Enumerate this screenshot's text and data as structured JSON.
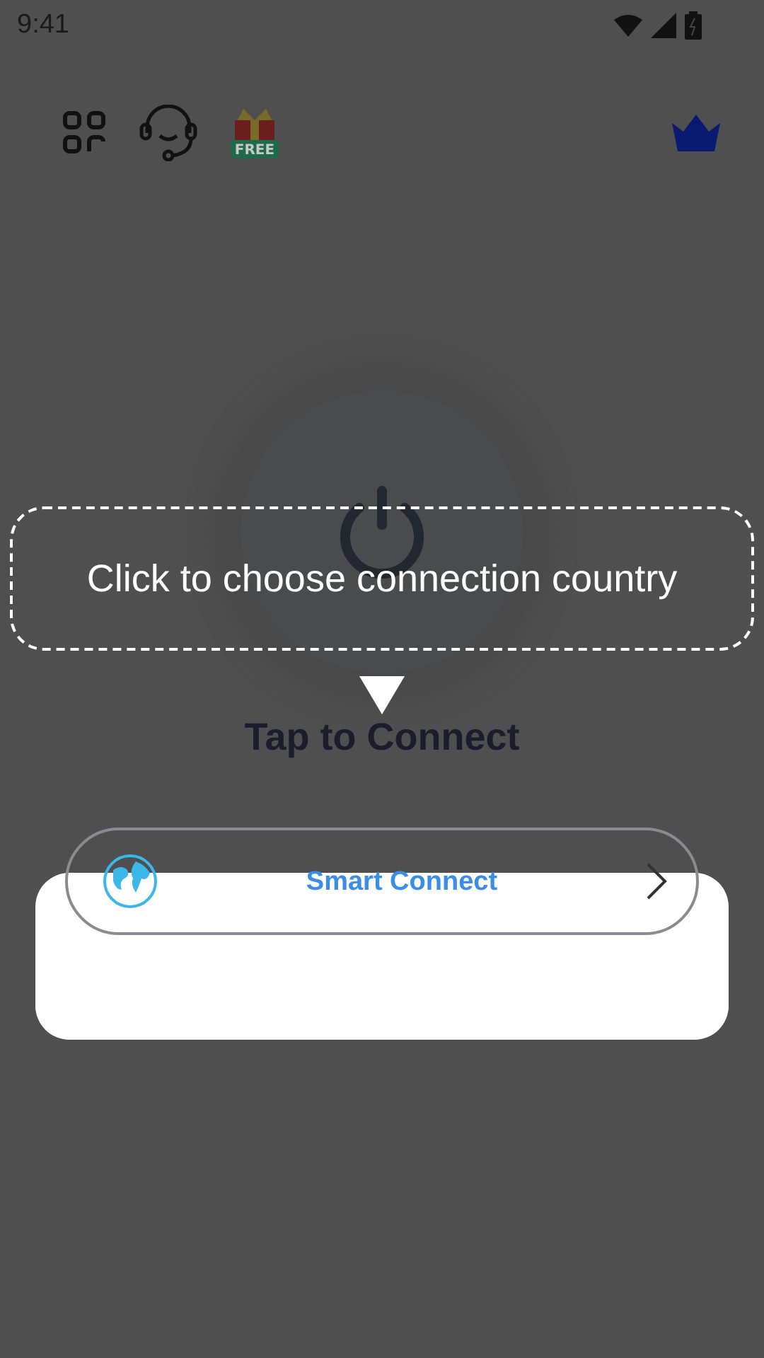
{
  "status_bar": {
    "time": "9:41"
  },
  "toolbar": {
    "gift_badge": "FREE"
  },
  "main": {
    "status_label": "Tap to Connect",
    "server_button": {
      "label": "Smart Connect"
    }
  },
  "coach_mark": {
    "text": "Click to choose connection country"
  }
}
